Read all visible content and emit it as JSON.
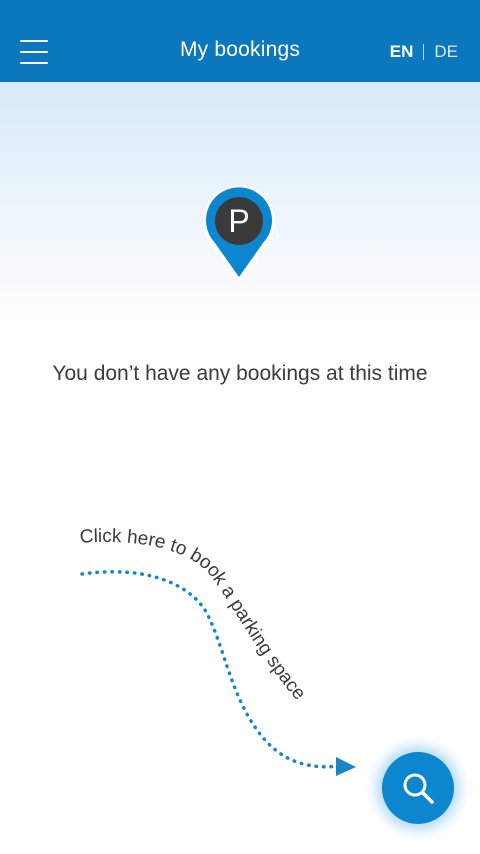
{
  "header": {
    "title": "My bookings",
    "lang_en": "EN",
    "lang_de": "DE",
    "menu_icon": "hamburger-menu-icon"
  },
  "main": {
    "pin_letter": "P",
    "empty_message": "You don’t have any bookings at this time",
    "hint_text": "Click here to book a parking space"
  },
  "fab": {
    "icon": "search-icon"
  },
  "colors": {
    "primary": "#0b77bd",
    "fab": "#0b86cf",
    "pin_dark": "#3a3a3a",
    "dots": "#1a86c8"
  }
}
